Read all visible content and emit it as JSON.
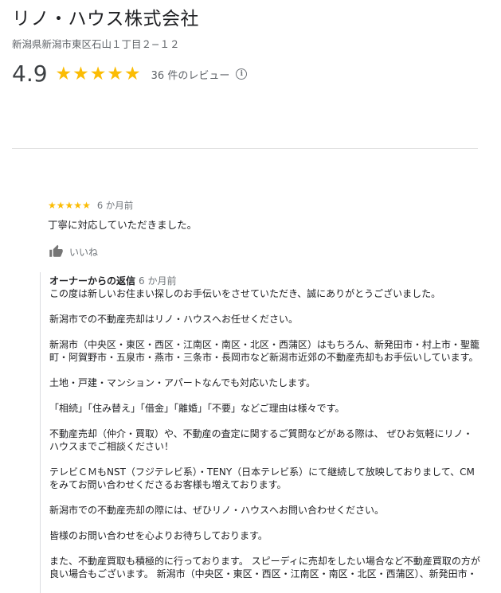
{
  "business": {
    "name": "リノ・ハウス株式会社",
    "address": "新潟県新潟市東区石山１丁目２−１２",
    "rating": "4.9",
    "stars": 5,
    "review_count_label": "36 件のレビュー",
    "info_icon": "info-icon"
  },
  "colors": {
    "star": "#fbbc04",
    "divider": "#e0e0e0",
    "reply_border": "#dadce0"
  },
  "review": {
    "stars": 5,
    "date": "6 か月前",
    "text": "丁寧に対応していただきました。",
    "like_icon": "thumbs-up-icon",
    "like_label": "いいね"
  },
  "owner_reply": {
    "title": "オーナーからの返信",
    "date": "6 か月前",
    "paragraphs": [
      "この度は新しいお住まい探しのお手伝いをさせていただき、誠にありがとうございました。",
      "新潟市での不動産売却はリノ・ハウスへお任せください。",
      "新潟市（中央区・東区・西区・江南区・南区・北区・西蒲区）はもちろん、新発田市・村上市・聖籠町・阿賀野市・五泉市・燕市・三条市・長岡市など新潟市近郊の不動産売却もお手伝いしています。",
      "土地・戸建・マンション・アパートなんでも対応いたします。",
      "「相続」「住み替え」「借金」「離婚」「不要」などご理由は様々です。",
      "不動産売却（仲介・買取）や、不動産の査定に関するご質問などがある際は、 ぜひお気軽にリノ・ハウスまでご相談ください！",
      "テレビＣＭもNST（フジテレビ系）・TENY（日本テレビ系）にて継続して放映しておりまして、CMをみてお問い合わせくださるお客様も増えております。",
      "新潟市での不動産売却の際には、ぜひリノ・ハウスへお問い合わせください。",
      "皆様のお問い合わせを心よりお待ちしております。",
      "また、不動産買取も積極的に行っております。 スピーディに売却をしたい場合など不動産買取の方が良い場合もございます。 新潟市（中央区・東区・西区・江南区・南区・北区・西蒲区）、新発田市・"
    ]
  }
}
